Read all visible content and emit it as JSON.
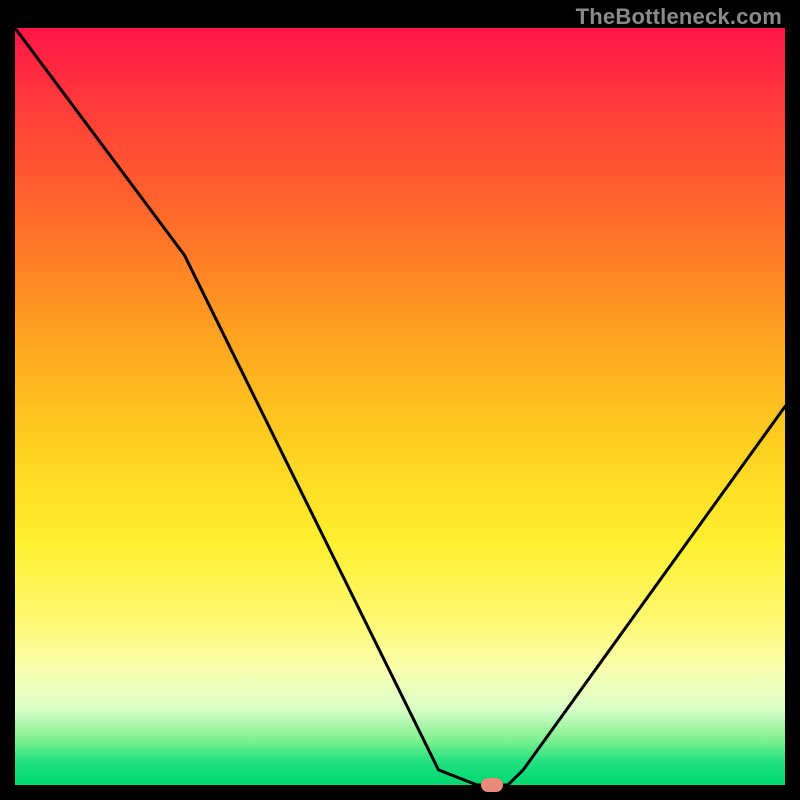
{
  "watermark": "TheBottleneck.com",
  "chart_data": {
    "type": "line",
    "title": "",
    "xlabel": "",
    "ylabel": "",
    "xlim": [
      0,
      100
    ],
    "ylim": [
      0,
      100
    ],
    "series": [
      {
        "name": "bottleneck-curve",
        "x": [
          0,
          22,
          55,
          60,
          64,
          66,
          100
        ],
        "values": [
          100,
          70,
          2,
          0,
          0,
          2,
          50
        ]
      }
    ],
    "marker": {
      "x": 62,
      "y": 0
    },
    "gradient_stops": [
      {
        "pos": 0,
        "color": "#ff1548"
      },
      {
        "pos": 25,
        "color": "#ff6a2a"
      },
      {
        "pos": 55,
        "color": "#ffd020"
      },
      {
        "pos": 85,
        "color": "#f8ffb0"
      },
      {
        "pos": 100,
        "color": "#00d870"
      }
    ]
  }
}
